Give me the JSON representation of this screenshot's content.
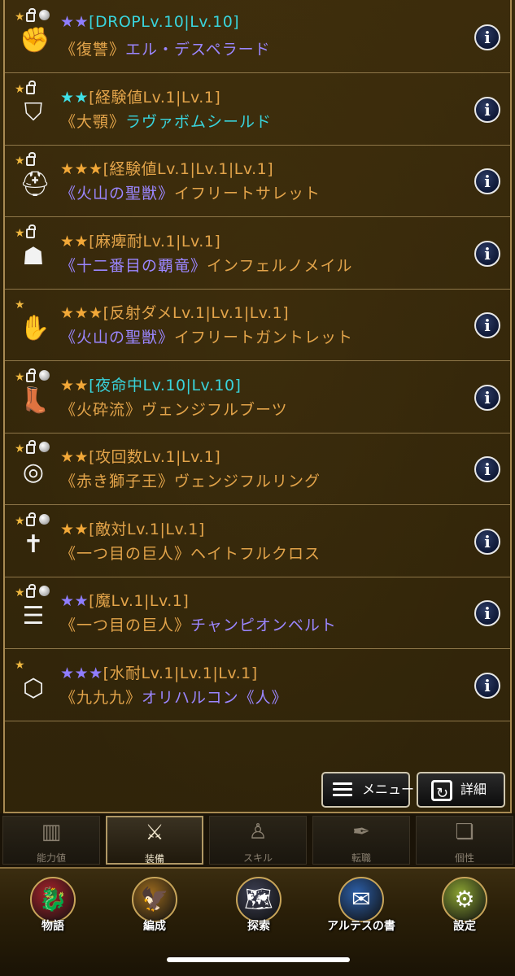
{
  "colors": {
    "star_purple": "#8f7dff",
    "star_cyan": "#3fe0e6",
    "star_gold": "#f2a838",
    "text_gold": "#e3a44a",
    "text_purple": "#9b86ff",
    "text_cyan": "#39d4dc"
  },
  "equipment": [
    {
      "stars": "★★",
      "star_color": "#8f7dff",
      "skill": "[DROPLv.10|Lv.10]",
      "skill_color": "#39d4dc",
      "epithet": "《復讐》",
      "epithet_color": "#e3a44a",
      "name": "エル・デスペラード",
      "name_color": "#9b86ff",
      "icon": "knuckle-icon",
      "glyph": "✊",
      "locked": true,
      "favorite": true
    },
    {
      "stars": "★★",
      "star_color": "#3fe0e6",
      "skill": "[経験値Lv.1|Lv.1]",
      "skill_color": "#e3a44a",
      "epithet": "《大顎》",
      "epithet_color": "#e3a44a",
      "name": "ラヴァボムシールド",
      "name_color": "#39d4dc",
      "icon": "shield-icon",
      "glyph": "⛉",
      "locked": true,
      "favorite": false
    },
    {
      "stars": "★★★",
      "star_color": "#f2a838",
      "skill": "[経験値Lv.1|Lv.1|Lv.1]",
      "skill_color": "#e3a44a",
      "epithet": "《火山の聖獣》",
      "epithet_color": "#9b86ff",
      "name": "イフリートサレット",
      "name_color": "#e3a44a",
      "icon": "helmet-icon",
      "glyph": "⛑",
      "locked": true,
      "favorite": false
    },
    {
      "stars": "★★",
      "star_color": "#f2a838",
      "skill": "[麻痺耐Lv.1|Lv.1]",
      "skill_color": "#e3a44a",
      "epithet": "《十二番目の覇竜》",
      "epithet_color": "#9b86ff",
      "name": "インフェルノメイル",
      "name_color": "#e3a44a",
      "icon": "armor-icon",
      "glyph": "☗",
      "locked": true,
      "favorite": false
    },
    {
      "stars": "★★★",
      "star_color": "#f2a838",
      "skill": "[反射ダメLv.1|Lv.1|Lv.1]",
      "skill_color": "#e3a44a",
      "epithet": "《火山の聖獣》",
      "epithet_color": "#9b86ff",
      "name": "イフリートガントレット",
      "name_color": "#e3a44a",
      "icon": "gauntlet-icon",
      "glyph": "✋",
      "locked": false,
      "favorite": false
    },
    {
      "stars": "★★",
      "star_color": "#f2a838",
      "skill": "[夜命中Lv.10|Lv.10]",
      "skill_color": "#39d4dc",
      "epithet": "《火砕流》",
      "epithet_color": "#e3a44a",
      "name": "ヴェンジフルブーツ",
      "name_color": "#e3a44a",
      "icon": "boots-icon",
      "glyph": "👢",
      "locked": true,
      "favorite": true
    },
    {
      "stars": "★★",
      "star_color": "#f2a838",
      "skill": "[攻回数Lv.1|Lv.1]",
      "skill_color": "#e3a44a",
      "epithet": "《赤き獅子王》",
      "epithet_color": "#e3a44a",
      "name": "ヴェンジフルリング",
      "name_color": "#e3a44a",
      "icon": "ring-icon",
      "glyph": "◎",
      "locked": true,
      "favorite": true
    },
    {
      "stars": "★★",
      "star_color": "#f2a838",
      "skill": "[敵対Lv.1|Lv.1]",
      "skill_color": "#e3a44a",
      "epithet": "《一つ目の巨人》",
      "epithet_color": "#e3a44a",
      "name": "ヘイトフルクロス",
      "name_color": "#e3a44a",
      "icon": "necklace-icon",
      "glyph": "✝",
      "locked": true,
      "favorite": true
    },
    {
      "stars": "★★",
      "star_color": "#8f7dff",
      "skill": "[魔Lv.1|Lv.1]",
      "skill_color": "#e3a44a",
      "epithet": "《一つ目の巨人》",
      "epithet_color": "#e3a44a",
      "name": "チャンピオンベルト",
      "name_color": "#9b86ff",
      "icon": "belt-icon",
      "glyph": "☰",
      "locked": true,
      "favorite": true
    },
    {
      "stars": "★★★",
      "star_color": "#8f7dff",
      "skill": "[水耐Lv.1|Lv.1|Lv.1]",
      "skill_color": "#e3a44a",
      "epithet": "《九九九》",
      "epithet_color": "#e3a44a",
      "name": "オリハルコン《人》",
      "name_color": "#9b86ff",
      "icon": "gem-icon",
      "glyph": "⬡",
      "locked": false,
      "favorite": false
    }
  ],
  "info_label": "i",
  "buttons": {
    "menu": "メニュー",
    "detail": "詳細"
  },
  "tabs": [
    {
      "label": "能力値",
      "icon": "bar-chart-icon",
      "glyph": "▥",
      "active": false
    },
    {
      "label": "装備",
      "icon": "sword-icon",
      "glyph": "⚔",
      "active": true
    },
    {
      "label": "スキル",
      "icon": "skill-tree-icon",
      "glyph": "♙",
      "active": false
    },
    {
      "label": "転職",
      "icon": "quill-icon",
      "glyph": "✒",
      "active": false
    },
    {
      "label": "個性",
      "icon": "scroll-icon",
      "glyph": "❏",
      "active": false
    }
  ],
  "nav": [
    {
      "label": "物語",
      "icon": "dragon-icon",
      "glyph": "🐉",
      "bg": "#a8232b"
    },
    {
      "label": "編成",
      "icon": "phoenix-icon",
      "glyph": "🦅",
      "bg": "#9b6a1e"
    },
    {
      "label": "探索",
      "icon": "map-icon",
      "glyph": "🗺",
      "bg": "#3c3f52"
    },
    {
      "label": "アルテスの書",
      "icon": "letter-icon",
      "glyph": "✉",
      "bg": "#2c5fa8"
    },
    {
      "label": "設定",
      "icon": "settings-gear-icon",
      "glyph": "⚙",
      "bg": "#8aa232"
    }
  ]
}
